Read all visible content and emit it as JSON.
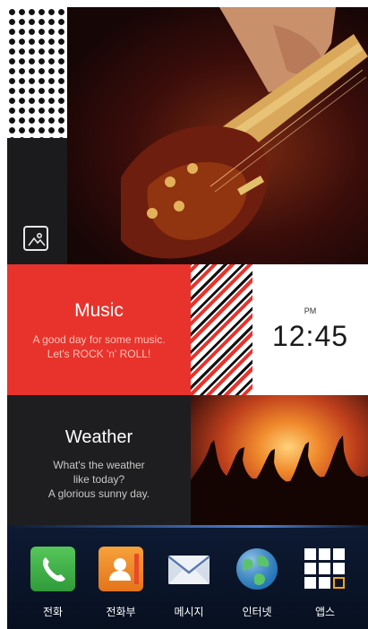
{
  "music": {
    "title": "Music",
    "subtitle_line1": "A good day for some music.",
    "subtitle_line2": "Let's ROCK 'n' ROLL!"
  },
  "clock": {
    "ampm": "PM",
    "time": "12:45"
  },
  "weather": {
    "title": "Weather",
    "line1": "What's the weather",
    "line2": "like today?",
    "line3": "A glorious sunny day."
  },
  "dock": {
    "items": [
      {
        "label": "전화",
        "icon": "phone-icon"
      },
      {
        "label": "전화부",
        "icon": "contacts-icon"
      },
      {
        "label": "메시지",
        "icon": "message-icon"
      },
      {
        "label": "인터넷",
        "icon": "globe-icon"
      },
      {
        "label": "앱스",
        "icon": "apps-grid-icon"
      }
    ]
  },
  "colors": {
    "music_red": "#e8332c",
    "dock_bg": "#0a1428",
    "phone_green": "#3cb34a",
    "contacts_orange": "#f08a24",
    "internet_blue": "#2e8fd6"
  }
}
